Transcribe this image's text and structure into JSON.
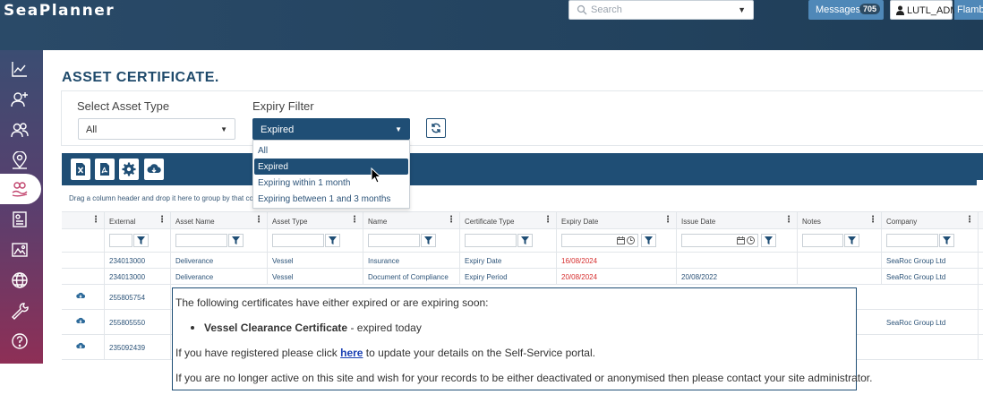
{
  "header": {
    "logo": "SeaPlanner",
    "search_placeholder": "Search",
    "messages_label": "Messages",
    "messages_count": "705",
    "user_label": "LUTL_ADM",
    "org_label": "Flamborough"
  },
  "sidebar": {
    "items": [
      {
        "icon": "chart-line-icon"
      },
      {
        "icon": "user-add-icon"
      },
      {
        "icon": "users-icon"
      },
      {
        "icon": "map-pin-icon"
      },
      {
        "icon": "certificate-hand-icon",
        "active": true
      },
      {
        "icon": "id-card-icon"
      },
      {
        "icon": "image-icon"
      },
      {
        "icon": "globe-icon"
      },
      {
        "icon": "wrench-icon"
      },
      {
        "icon": "help-icon"
      }
    ]
  },
  "page": {
    "title": "ASSET CERTIFICATE.",
    "asset_type_label": "Select Asset Type",
    "asset_type_value": "All",
    "expiry_filter_label": "Expiry Filter",
    "expiry_filter_value": "Expired",
    "group_hint": "Drag a column header and drop it here to group by that column"
  },
  "toolbar": {
    "buttons": [
      "excel-export-icon",
      "pdf-export-icon",
      "settings-icon",
      "cloud-download-icon"
    ]
  },
  "dropdown": {
    "options": [
      "All",
      "Expired",
      "Expiring within 1 month",
      "Expiring between 1 and 3 months"
    ],
    "selected": "Expired"
  },
  "grid": {
    "columns": [
      "External",
      "Asset Name",
      "Asset Type",
      "Name",
      "Certificate Type",
      "Expiry Date",
      "Issue Date",
      "Notes",
      "Company"
    ],
    "rows": [
      {
        "external": "234013000",
        "asset_name": "Deliverance",
        "asset_type": "Vessel",
        "name": "Insurance",
        "cert_type": "Expiry Date",
        "expiry": "16/08/2024",
        "issue": "",
        "notes": "",
        "company": "SeaRoc Group Ltd"
      },
      {
        "external": "234013000",
        "asset_name": "Deliverance",
        "asset_type": "Vessel",
        "name": "Document of Compliance",
        "cert_type": "Expiry Period",
        "expiry": "20/08/2024",
        "issue": "20/08/2022",
        "notes": "",
        "company": "SeaRoc Group Ltd"
      },
      {
        "external": "255805754",
        "company": ""
      },
      {
        "external": "255805550",
        "company": "SeaRoc Group Ltd"
      },
      {
        "external": "235092439",
        "company": ""
      }
    ]
  },
  "popup": {
    "intro": "The following certificates have either expired or are expiring soon:",
    "item_bold": "Vessel Clearance Certificate",
    "item_rest": " - expired today",
    "registered_pre": "If you have registered please click ",
    "registered_link": "here",
    "registered_post": " to update your details on the Self-Service portal.",
    "inactive": "If you are no longer active on this site and wish for your records to be either deactivated or anonymised then please contact your site administrator."
  },
  "colors": {
    "primary": "#1f4e75",
    "header": "#23435f",
    "accent": "#4f88b8",
    "expired_text": "#d63030"
  }
}
